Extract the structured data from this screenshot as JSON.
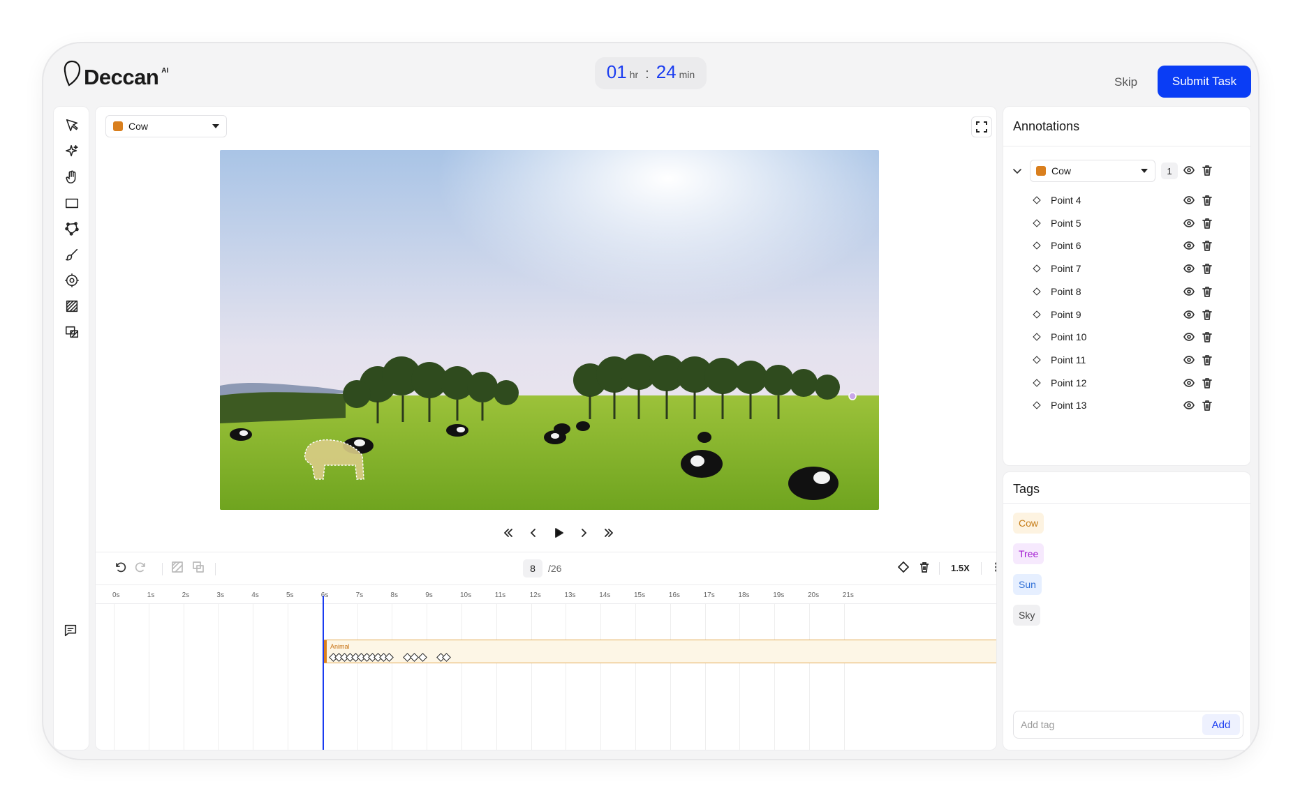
{
  "header": {
    "logo_name": "Deccan",
    "logo_sup": "AI",
    "timer_hours": "01",
    "timer_hours_unit": "hr",
    "timer_sep": ":",
    "timer_minutes": "24",
    "timer_minutes_unit": "min",
    "skip_label": "Skip",
    "submit_label": "Submit Task"
  },
  "tools": [
    "select-arrow-icon",
    "magic-sparkle-icon",
    "hand-pan-icon",
    "rectangle-icon",
    "polygon-icon",
    "brush-icon",
    "target-point-icon",
    "hatch-mask-icon",
    "segment-icon"
  ],
  "canvas": {
    "class_select": "Cow",
    "class_color": "#d97f1e"
  },
  "timeline": {
    "current_frame": "8",
    "total_frames": "/26",
    "speed": "1.5X",
    "ticks": [
      "0s",
      "1s",
      "2s",
      "3s",
      "4s",
      "5s",
      "6s",
      "7s",
      "8s",
      "9s",
      "10s",
      "11s",
      "12s",
      "13s",
      "14s",
      "15s",
      "16s",
      "17s",
      "18s",
      "19s",
      "20s",
      "21s"
    ],
    "track_label": "Animal"
  },
  "annotations": {
    "title": "Annotations",
    "group_class": "Cow",
    "group_count": "1",
    "points": [
      "Point 4",
      "Point 5",
      "Point 6",
      "Point 7",
      "Point 8",
      "Point 9",
      "Point 10",
      "Point 11",
      "Point 12",
      "Point 13"
    ]
  },
  "tags": {
    "title": "Tags",
    "items": [
      {
        "label": "Cow",
        "color": "#c57a14",
        "bg": "#fdf3e1"
      },
      {
        "label": "Tree",
        "color": "#a21ad1",
        "bg": "#f6e9fd"
      },
      {
        "label": "Sun",
        "color": "#2f6fd6",
        "bg": "#e6efff"
      },
      {
        "label": "Sky",
        "color": "#444444",
        "bg": "#f0f0f2"
      }
    ],
    "input_placeholder": "Add tag",
    "add_label": "Add"
  }
}
